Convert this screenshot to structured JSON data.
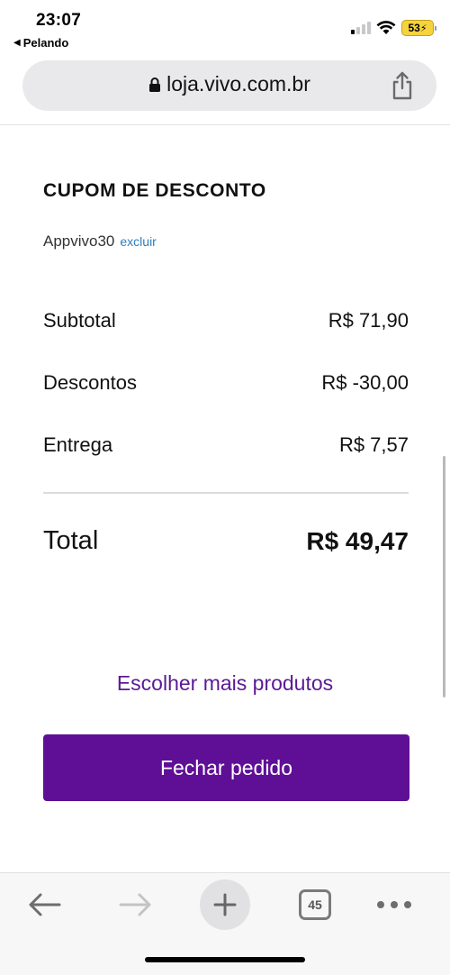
{
  "status_bar": {
    "time": "23:07",
    "back_app": "Pelando",
    "battery": "53"
  },
  "browser": {
    "url": "loja.vivo.com.br",
    "tab_count": "45"
  },
  "coupon": {
    "heading": "CUPOM DE DESCONTO",
    "code": "Appvivo30",
    "remove_label": "excluir"
  },
  "summary": {
    "subtotal_label": "Subtotal",
    "subtotal_value": "R$ 71,90",
    "discounts_label": "Descontos",
    "discounts_value": "R$ -30,00",
    "delivery_label": "Entrega",
    "delivery_value": "R$ 7,57",
    "total_label": "Total",
    "total_value": "R$ 49,47"
  },
  "actions": {
    "more_products": "Escolher mais produtos",
    "checkout": "Fechar pedido"
  },
  "colors": {
    "brand_purple": "#5f0f96",
    "link_purple": "#5a1a94",
    "link_blue": "#2d7fc1",
    "battery_yellow": "#f5d33c"
  }
}
